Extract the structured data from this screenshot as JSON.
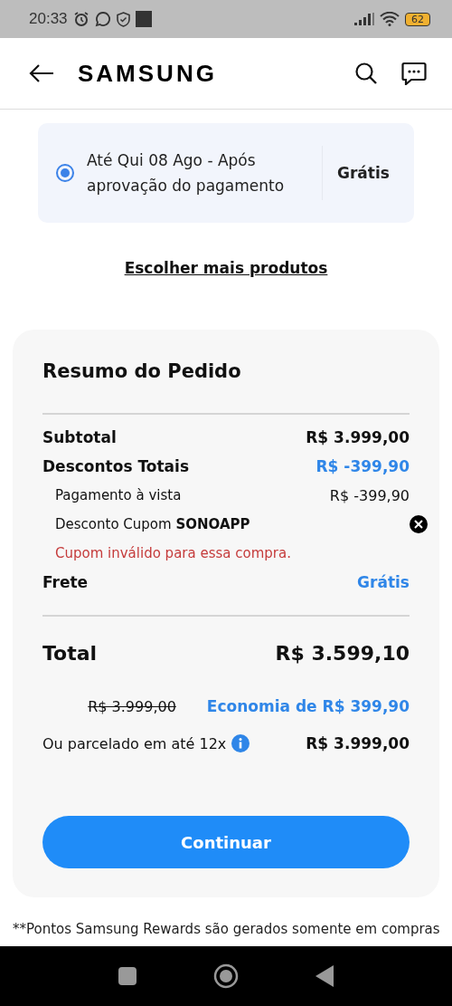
{
  "status_bar": {
    "time": "20:33",
    "battery": "62"
  },
  "header": {
    "logo": "SAMSUNG"
  },
  "delivery_option": {
    "label": "Até Qui 08 Ago - Após aprovação do pagamento",
    "price": "Grátis",
    "selected": true
  },
  "more_products_link": "Escolher mais produtos",
  "order_summary": {
    "title": "Resumo do Pedido",
    "lines": [
      {
        "kind": "main",
        "label": "Subtotal",
        "value": "R$ 3.999,00",
        "highlight": false
      },
      {
        "kind": "main",
        "label": "Descontos Totais",
        "value": "R$ -399,90",
        "highlight": true
      },
      {
        "kind": "sub",
        "label": "Pagamento à vista",
        "value": "R$ -399,90",
        "highlight": false
      },
      {
        "kind": "coupon",
        "label": "Desconto Cupom **SONOAPP**",
        "error": "Cupom inválido para essa compra."
      },
      {
        "kind": "main",
        "label": "Frete",
        "value": "Grátis",
        "highlight": true
      }
    ],
    "total": {
      "label": "Total",
      "value": "R$ 3.599,10",
      "old_price": "R$ 3.999,00",
      "savings": "Economia de R$ 399,90"
    },
    "installments": {
      "label": "Ou parcelado em até 12x",
      "value": "R$ 3.999,00"
    },
    "button": "Continuar"
  },
  "footnote": "**Pontos Samsung Rewards são gerados somente em compras"
}
